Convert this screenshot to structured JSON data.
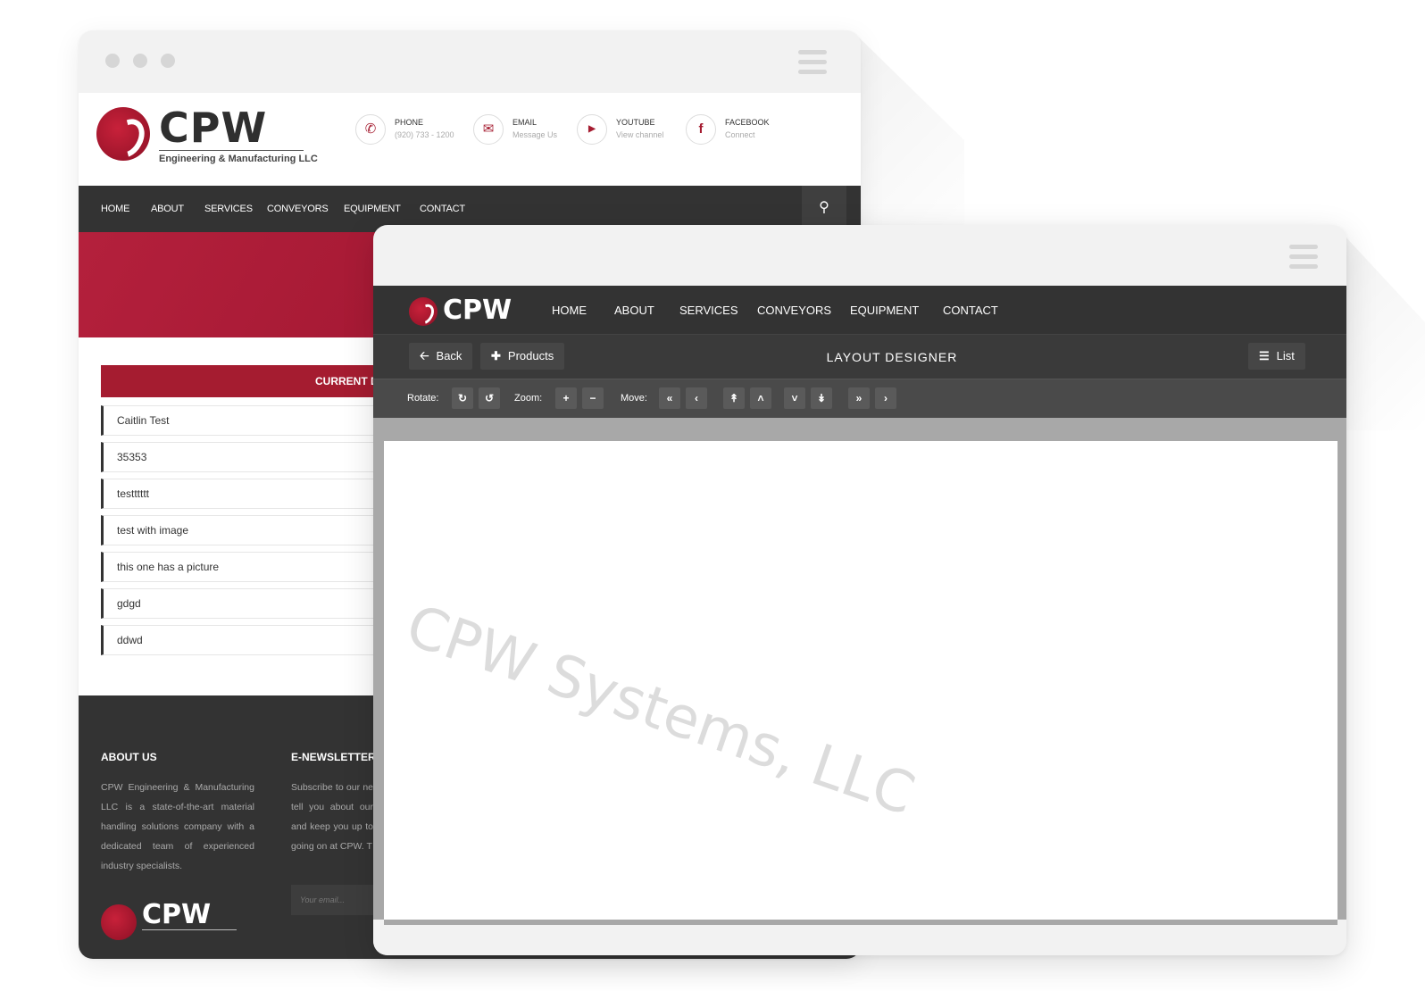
{
  "colors": {
    "brand_red": "#a51c30",
    "nav_dark": "#333333",
    "canvas_gray": "#a8a8a8"
  },
  "back_site": {
    "logo": {
      "text": "CPW",
      "subtitle": "Engineering & Manufacturing LLC"
    },
    "contacts": [
      {
        "icon": "phone-icon",
        "label": "PHONE",
        "value": "(920) 733 - 1200"
      },
      {
        "icon": "envelope-icon",
        "label": "EMAIL",
        "value": "Message Us"
      },
      {
        "icon": "youtube-icon",
        "label": "YOUTUBE",
        "value": "View channel"
      },
      {
        "icon": "facebook-icon",
        "label": "FACEBOOK",
        "value": "Connect"
      }
    ],
    "nav": [
      "HOME",
      "ABOUT",
      "SERVICES",
      "CONVEYORS",
      "EQUIPMENT",
      "CONTACT"
    ],
    "panel_title": "CURRENT D",
    "list_items": [
      "Caitlin Test",
      "35353",
      "testttttt",
      "test with image",
      "this one has a picture",
      "gdgd",
      "ddwd"
    ],
    "footer": {
      "about_heading": "ABOUT US",
      "about_text": "CPW Engineering & Manufacturing LLC is a state-of-the-art material handling solutions company with a dedicated team of experienced industry specialists.",
      "newsletter_heading": "E-NEWSLETTER",
      "newsletter_text": "Subscribe to our ne tell you about our and keep you up to going on at CPW. T",
      "email_placeholder": "Your email...",
      "logo_text": "CPW"
    }
  },
  "front_app": {
    "logo_text": "CPW",
    "nav": [
      "HOME",
      "ABOUT",
      "SERVICES",
      "CONVEYORS",
      "EQUIPMENT",
      "CONTACT"
    ],
    "toolbar": {
      "back_label": "Back",
      "products_label": "Products",
      "title": "LAYOUT  DESIGNER",
      "list_label": "List"
    },
    "controls": {
      "rotate_label": "Rotate:",
      "zoom_label": "Zoom:",
      "move_label": "Move:"
    },
    "watermark": "CPW Systems, LLC"
  }
}
